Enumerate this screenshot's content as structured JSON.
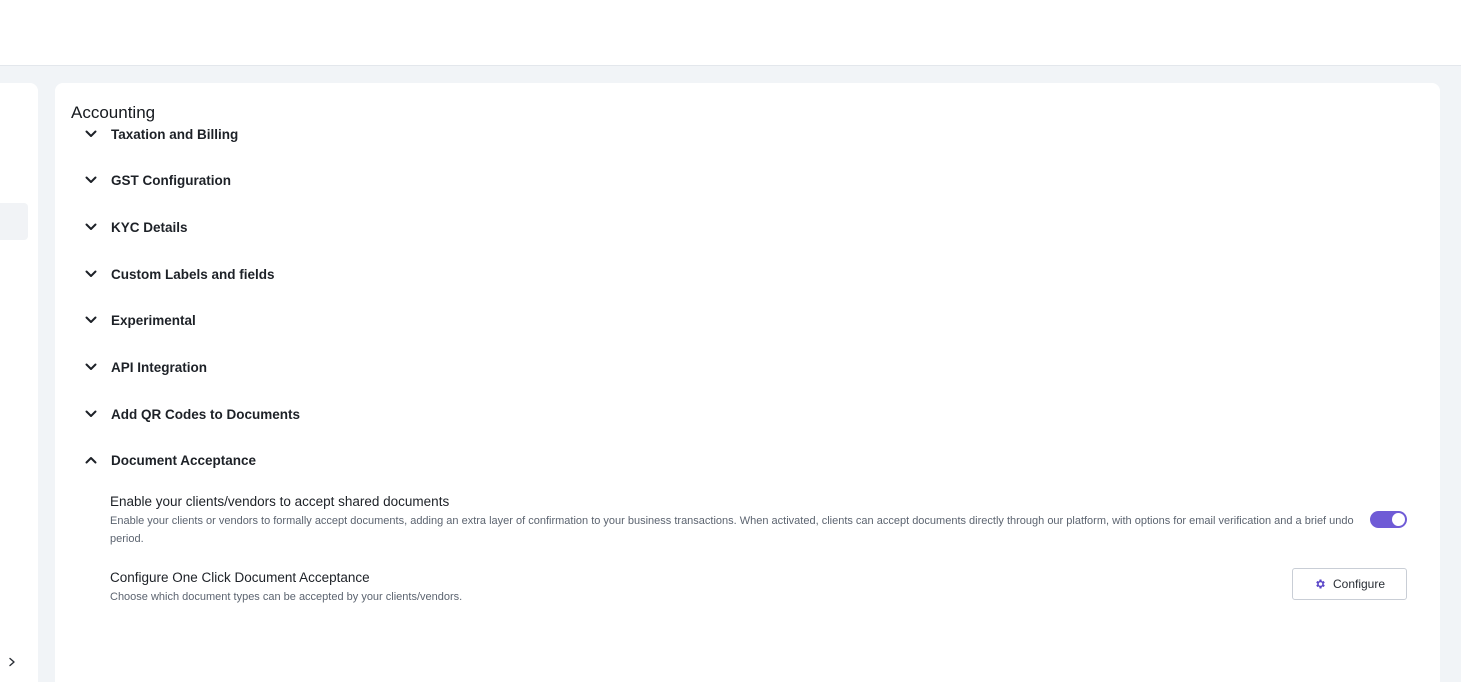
{
  "panel": {
    "title": "Accounting"
  },
  "sections": [
    {
      "label": "Taxation and Billing",
      "expanded": false
    },
    {
      "label": "GST Configuration",
      "expanded": false
    },
    {
      "label": "KYC Details",
      "expanded": false
    },
    {
      "label": "Custom Labels and fields",
      "expanded": false
    },
    {
      "label": "Experimental",
      "expanded": false
    },
    {
      "label": "API Integration",
      "expanded": false
    },
    {
      "label": "Add QR Codes to Documents",
      "expanded": false
    },
    {
      "label": "Document Acceptance",
      "expanded": true
    }
  ],
  "document_acceptance": {
    "enable_setting": {
      "title": "Enable your clients/vendors to accept shared documents",
      "description": "Enable your clients or vendors to formally accept documents, adding an extra layer of confirmation to your business transactions. When activated, clients can accept documents directly through our platform, with options for email verification and a brief undo period.",
      "enabled": true
    },
    "configure_setting": {
      "title": "Configure One Click Document Acceptance",
      "description": "Choose which document types can be accepted by your clients/vendors.",
      "button_label": "Configure"
    }
  },
  "colors": {
    "accent": "#6f5bd6",
    "background": "#f1f4f7",
    "text": "#1d2127",
    "muted_text": "#5c6470"
  },
  "icons": {
    "collapsed": "chevron-down-icon",
    "expanded": "chevron-up-icon",
    "sidebar_expand": "chevron-right-icon",
    "configure": "gear-icon"
  }
}
